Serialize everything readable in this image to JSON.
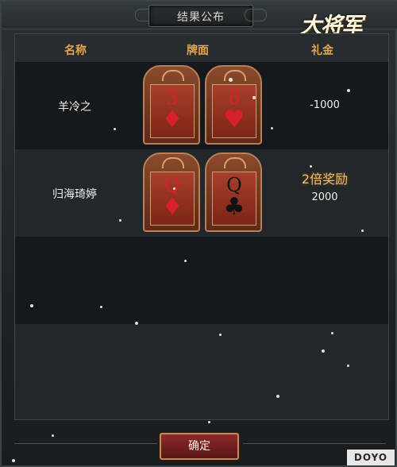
{
  "window": {
    "title": "结果公布",
    "logo_text": "大将军",
    "watermark": "DOYO"
  },
  "table": {
    "headers": {
      "name": "名称",
      "cards": "牌面",
      "gift": "礼金"
    },
    "rows": [
      {
        "name": "羊冷之",
        "cards": [
          {
            "rank": "3",
            "suit": "♦",
            "suit_name": "diamond",
            "color": "red"
          },
          {
            "rank": "8",
            "suit": "♥",
            "suit_name": "heart",
            "color": "red"
          }
        ],
        "bonus": "",
        "gift": "-1000"
      },
      {
        "name": "归海琦婷",
        "cards": [
          {
            "rank": "Q",
            "suit": "♦",
            "suit_name": "diamond",
            "color": "red"
          },
          {
            "rank": "Q",
            "suit": "♣",
            "suit_name": "club",
            "color": "black"
          }
        ],
        "bonus": "2倍奖励",
        "gift": "2000"
      }
    ]
  },
  "buttons": {
    "confirm": "确定"
  },
  "colors": {
    "header_gold": "#e6a64a",
    "bonus_gold": "#f0c070",
    "card_red": "#d8202a",
    "button_red": "#8c2a2a"
  }
}
